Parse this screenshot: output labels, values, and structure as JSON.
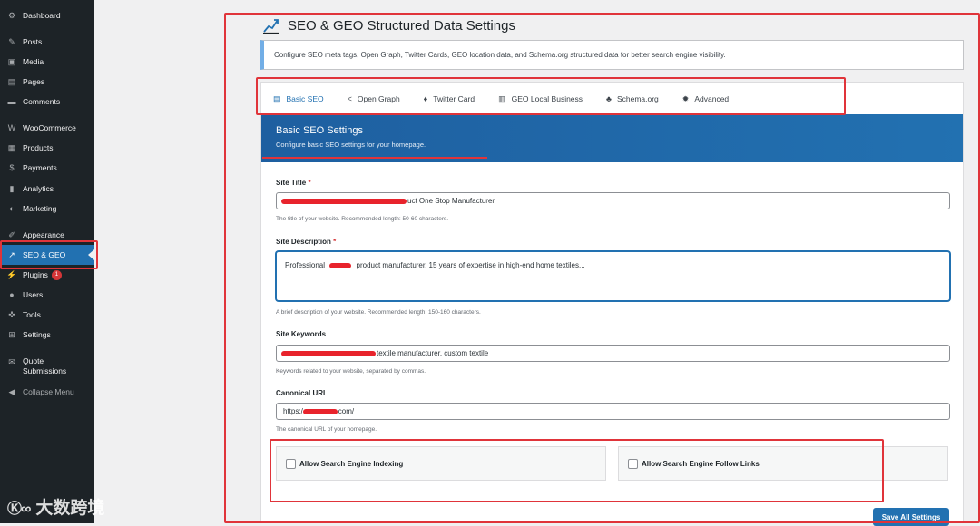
{
  "sidebar": {
    "items": [
      {
        "label": "Dashboard",
        "icon": "dashboard-icon",
        "glyph": "⚙"
      },
      {
        "label": "Posts",
        "icon": "pin-icon",
        "glyph": "✎"
      },
      {
        "label": "Media",
        "icon": "media-icon",
        "glyph": "▣"
      },
      {
        "label": "Pages",
        "icon": "pages-icon",
        "glyph": "▤"
      },
      {
        "label": "Comments",
        "icon": "comments-icon",
        "glyph": "▬"
      },
      {
        "label": "WooCommerce",
        "icon": "woocommerce-icon",
        "glyph": "W"
      },
      {
        "label": "Products",
        "icon": "products-icon",
        "glyph": "▦"
      },
      {
        "label": "Payments",
        "icon": "payments-icon",
        "glyph": "$"
      },
      {
        "label": "Analytics",
        "icon": "analytics-icon",
        "glyph": "▮"
      },
      {
        "label": "Marketing",
        "icon": "marketing-icon",
        "glyph": "◐"
      },
      {
        "label": "Appearance",
        "icon": "brush-icon",
        "glyph": "✐"
      },
      {
        "label": "SEO & GEO",
        "icon": "chart-line-icon",
        "glyph": "↗"
      },
      {
        "label": "Plugins",
        "icon": "plugin-icon",
        "glyph": "⚡",
        "badge": "1"
      },
      {
        "label": "Users",
        "icon": "users-icon",
        "glyph": "●"
      },
      {
        "label": "Tools",
        "icon": "wrench-icon",
        "glyph": "✜"
      },
      {
        "label": "Settings",
        "icon": "settings-icon",
        "glyph": "⊞"
      },
      {
        "label": "Quote Submissions",
        "icon": "envelope-icon",
        "glyph": "✉"
      },
      {
        "label": "Collapse Menu",
        "icon": "collapse-icon",
        "glyph": "◀"
      }
    ]
  },
  "header": {
    "title": "SEO & GEO Structured Data Settings"
  },
  "notice": {
    "text": "Configure SEO meta tags, Open Graph, Twitter Cards, GEO location data, and Schema.org structured data for better search engine visibility."
  },
  "tabs": [
    {
      "label": "Basic SEO",
      "icon": "id-card-icon",
      "glyph": "▤",
      "active": true
    },
    {
      "label": "Open Graph",
      "icon": "share-icon",
      "glyph": "<"
    },
    {
      "label": "Twitter Card",
      "icon": "twitter-icon",
      "glyph": "♦"
    },
    {
      "label": "GEO Local Business",
      "icon": "store-icon",
      "glyph": "▥"
    },
    {
      "label": "Schema.org",
      "icon": "sitemap-icon",
      "glyph": "♣"
    },
    {
      "label": "Advanced",
      "icon": "gear-icon",
      "glyph": "✹"
    }
  ],
  "section": {
    "title": "Basic SEO Settings",
    "subtitle": "Configure basic SEO settings for your homepage."
  },
  "fields": {
    "site_title": {
      "label": "Site Title",
      "required": "*",
      "value_suffix": "uct One Stop Manufacturer",
      "help": "The title of your website. Recommended length: 50-60 characters."
    },
    "site_description": {
      "label": "Site Description",
      "required": "*",
      "value_prefix": "Professional",
      "value_suffix": "product manufacturer, 15 years of expertise in high-end home textiles...",
      "help": "A brief description of your website. Recommended length: 150-160 characters."
    },
    "site_keywords": {
      "label": "Site Keywords",
      "value_suffix": "textile manufacturer, custom textile",
      "help": "Keywords related to your website, separated by commas."
    },
    "canonical_url": {
      "label": "Canonical URL",
      "value_prefix": "https:/",
      "value_suffix": "com/",
      "help": "The canonical URL of your homepage."
    }
  },
  "checkboxes": {
    "indexing": {
      "label": "Allow Search Engine Indexing",
      "checked": false
    },
    "follow": {
      "label": "Allow Search Engine Follow Links",
      "checked": false
    }
  },
  "buttons": {
    "save": "Save All Settings"
  },
  "watermark": {
    "logo": "Ⓚ∞",
    "text": "大数跨境"
  },
  "colors": {
    "accent": "#2271b1",
    "sidebar": "#1d2327",
    "annotation": "#e0343a",
    "redaction": "#e8232c"
  }
}
